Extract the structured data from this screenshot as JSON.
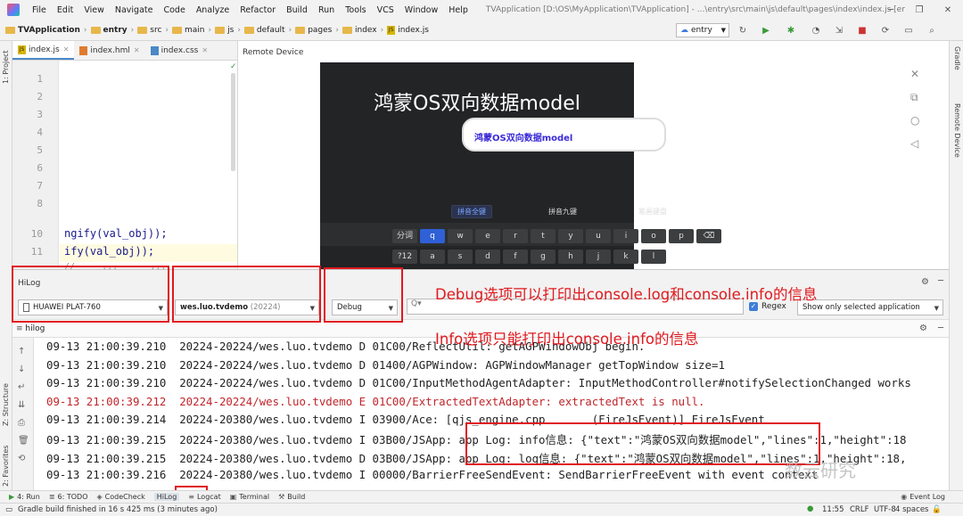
{
  "window": {
    "menu": [
      "File",
      "Edit",
      "View",
      "Navigate",
      "Code",
      "Analyze",
      "Refactor",
      "Build",
      "Run",
      "Tools",
      "VCS",
      "Window",
      "Help"
    ],
    "title": "TVApplication [D:\\OS\\MyApplication\\TVApplication] - ...\\entry\\src\\main\\js\\default\\pages\\index\\index.js [entry]"
  },
  "breadcrumb": [
    "TVApplication",
    "entry",
    "src",
    "main",
    "js",
    "default",
    "pages",
    "index",
    "index.js"
  ],
  "run_config": "entry",
  "editor": {
    "tabs": [
      "index.js",
      "index.hml",
      "index.css"
    ],
    "line_numbers": [
      "1",
      "2",
      "3",
      "4",
      "5",
      "6",
      "7",
      "8",
      "10",
      "11"
    ],
    "code_lines": [
      "ngify(val_obj));",
      "ify(val_obj));"
    ],
    "cut_line": "//     ...      ..."
  },
  "remote": {
    "title": "Remote Device",
    "app_title": "鸿蒙OS双向数据model",
    "input_text": "鸿蒙OS双向数据model",
    "kbd_tabs": [
      "拼音全键",
      "拼音九键",
      "笔画键盘"
    ],
    "kbd_row1": [
      "分词",
      "q",
      "w",
      "e",
      "r",
      "t",
      "y",
      "u",
      "i",
      "o",
      "p",
      "⌫"
    ],
    "kbd_row2": [
      "?12",
      "a",
      "s",
      "d",
      "f",
      "g",
      "h",
      "j",
      "k",
      "l"
    ]
  },
  "hilog": {
    "panel_label": "HiLog",
    "device": "HUAWEI PLAT-760",
    "process": "wes.luo.tvdemo",
    "process_pid": "(20224)",
    "level": "Debug",
    "search_placeholder": "Q▾",
    "regex_label": "Regex",
    "scope": "Show only selected application",
    "sub_tab": "hilog",
    "lines": [
      {
        "text": "09-13 21:00:39.210  20224-20224/wes.luo.tvdemo D 01C00/ReflectUtil: getAGPWindowObj begin.",
        "level": "D"
      },
      {
        "text": "09-13 21:00:39.210  20224-20224/wes.luo.tvdemo D 01400/AGPWindow: AGPWindowManager getTopWindow size=1",
        "level": "D"
      },
      {
        "text": "09-13 21:00:39.210  20224-20224/wes.luo.tvdemo D 01C00/InputMethodAgentAdapter: InputMethodController#notifySelectionChanged works",
        "level": "D"
      },
      {
        "text": "09-13 21:00:39.212  20224-20224/wes.luo.tvdemo E 01C00/ExtractedTextAdapter: extractedText is null.",
        "level": "E"
      },
      {
        "text": "09-13 21:00:39.214  20224-20380/wes.luo.tvdemo I 03900/Ace: [qjs_engine.cpp       (FireJsEvent)] FireJsEvent",
        "level": "I"
      },
      {
        "text": "09-13 21:00:39.215  20224-20380/wes.luo.tvdemo I 03B00/JSApp: app Log: info信息: {\"text\":\"鸿蒙OS双向数据model\",\"lines\":1,\"height\":18",
        "level": "I"
      },
      {
        "text": "09-13 21:00:39.215  20224-20380/wes.luo.tvdemo D 03B00/JSApp: app Log: log信息: {\"text\":\"鸿蒙OS双向数据model\",\"lines\":1,\"height\":18,",
        "level": "D"
      },
      {
        "text": "09-13 21:00:39.216  20224-20380/wes.luo.tvdemo I 00000/BarrierFreeSendEvent: SendBarrierFreeEvent with event context",
        "level": "I"
      }
    ]
  },
  "annotations": {
    "debug_note": "Debug选项可以打印出console.log和console.info的信息",
    "info_note": "Info选项只能打印出console.info的信息"
  },
  "bottom_tabs": [
    "4: Run",
    "6: TODO",
    "CodeCheck",
    "HiLog",
    "Logcat",
    "Terminal",
    "Build"
  ],
  "event_log": "Event Log",
  "side_labels": {
    "project": "1: Project",
    "structure": "Z: Structure",
    "favorites": "2: Favorites",
    "gradle": "Gradle",
    "remote_device": "Remote Device"
  },
  "status": {
    "message": "Gradle build finished in 16 s 425 ms (3 minutes ago)",
    "time": "11:55",
    "line_sep": "CRLF",
    "encoding": "UTF-8",
    "indent": "4 spaces"
  },
  "watermark": "数云研究"
}
